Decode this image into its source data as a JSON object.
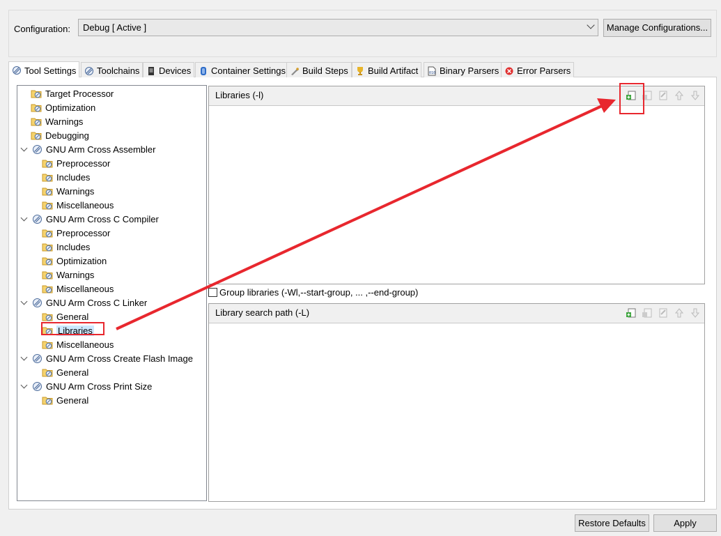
{
  "configuration": {
    "label": "Configuration:",
    "value": "Debug  [ Active ]",
    "manage_button": "Manage Configurations..."
  },
  "tabs": [
    {
      "label": "Tool Settings",
      "icon": "tool-settings-icon",
      "active": true
    },
    {
      "label": "Toolchains",
      "icon": "toolchains-icon"
    },
    {
      "label": "Devices",
      "icon": "devices-icon"
    },
    {
      "label": "Container Settings",
      "icon": "container-icon"
    },
    {
      "label": "Build Steps",
      "icon": "build-steps-icon"
    },
    {
      "label": "Build Artifact",
      "icon": "build-artifact-icon"
    },
    {
      "label": "Binary Parsers",
      "icon": "binary-parsers-icon"
    },
    {
      "label": "Error Parsers",
      "icon": "error-parsers-icon"
    }
  ],
  "tree": [
    {
      "label": "Target Processor",
      "level": 1
    },
    {
      "label": "Optimization",
      "level": 1
    },
    {
      "label": "Warnings",
      "level": 1
    },
    {
      "label": "Debugging",
      "level": 1
    },
    {
      "label": "GNU Arm Cross Assembler",
      "level": 0
    },
    {
      "label": "Preprocessor",
      "level": 2
    },
    {
      "label": "Includes",
      "level": 2
    },
    {
      "label": "Warnings",
      "level": 2
    },
    {
      "label": "Miscellaneous",
      "level": 2
    },
    {
      "label": "GNU Arm Cross C Compiler",
      "level": 0
    },
    {
      "label": "Preprocessor",
      "level": 2
    },
    {
      "label": "Includes",
      "level": 2
    },
    {
      "label": "Optimization",
      "level": 2
    },
    {
      "label": "Warnings",
      "level": 2
    },
    {
      "label": "Miscellaneous",
      "level": 2
    },
    {
      "label": "GNU Arm Cross C Linker",
      "level": 0
    },
    {
      "label": "General",
      "level": 2
    },
    {
      "label": "Libraries",
      "level": 2,
      "selected": true
    },
    {
      "label": "Miscellaneous",
      "level": 2
    },
    {
      "label": "GNU Arm Cross Create Flash Image",
      "level": 0
    },
    {
      "label": "General",
      "level": 2
    },
    {
      "label": "GNU Arm Cross Print Size",
      "level": 0
    },
    {
      "label": "General",
      "level": 2
    }
  ],
  "libraries_panel": {
    "title": "Libraries (-l)"
  },
  "group_libraries": {
    "label": "Group libraries (-Wl,--start-group, ... ,--end-group)",
    "checked": false
  },
  "search_path_panel": {
    "title": "Library search path (-L)"
  },
  "panel_tools": [
    "add-icon",
    "delete-icon",
    "edit-icon",
    "move-up-icon",
    "move-down-icon"
  ],
  "buttons": {
    "restore": "Restore Defaults",
    "apply": "Apply"
  },
  "colors": {
    "annotation": "#e8272e",
    "selection": "#cce8ff"
  }
}
